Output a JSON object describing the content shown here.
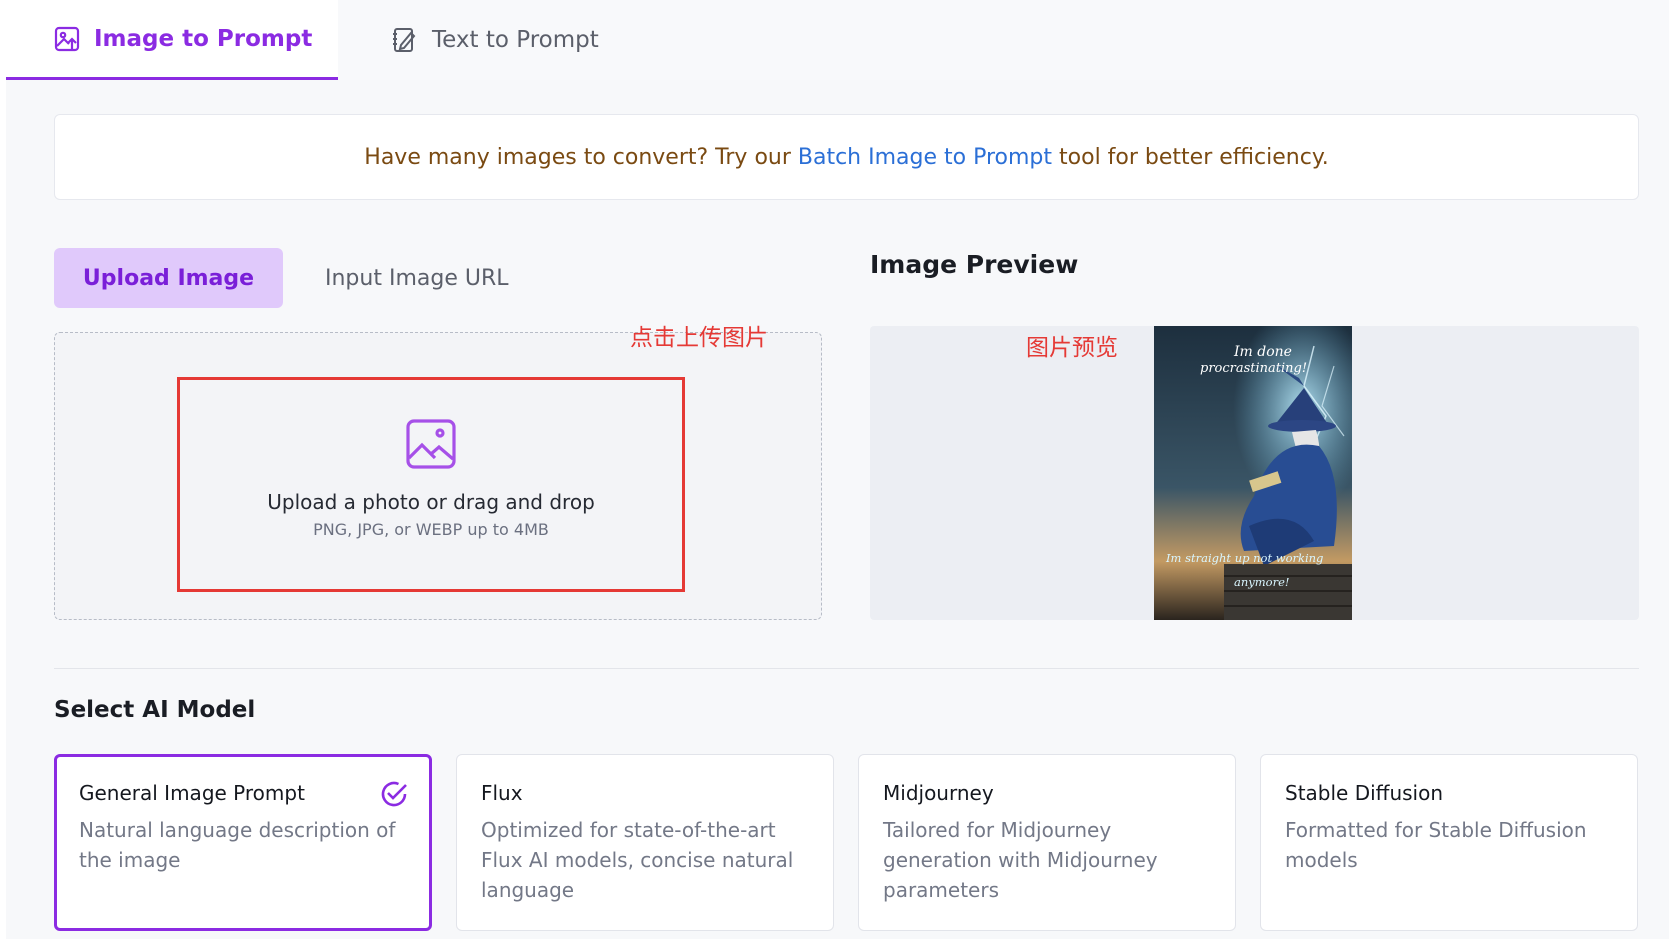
{
  "tabs": {
    "image_to_prompt": "Image to Prompt",
    "text_to_prompt": "Text to Prompt"
  },
  "banner": {
    "prefix": "Have many images to convert? Try our",
    "link": "Batch Image to Prompt",
    "suffix": "tool for better efficiency."
  },
  "upload": {
    "tab_upload": "Upload Image",
    "tab_url": "Input Image URL",
    "main_text": "Upload a photo or drag and drop",
    "sub_text": "PNG, JPG, or WEBP up to 4MB",
    "annotation": "点击上传图片"
  },
  "preview": {
    "title": "Image Preview",
    "annotation": "图片预览",
    "image_text_top_1": "Im done",
    "image_text_top_2": "procrastinating!",
    "image_text_bottom_1": "Im straight up not working",
    "image_text_bottom_2": "anymore!"
  },
  "models": {
    "title": "Select AI Model",
    "items": [
      {
        "name": "General Image Prompt",
        "description": "Natural language description of the image",
        "selected": true
      },
      {
        "name": "Flux",
        "description": "Optimized for state-of-the-art Flux AI models, concise natural language",
        "selected": false
      },
      {
        "name": "Midjourney",
        "description": "Tailored for Midjourney generation with Midjourney parameters",
        "selected": false
      },
      {
        "name": "Stable Diffusion",
        "description": "Formatted for Stable Diffusion models",
        "selected": false
      }
    ]
  },
  "colors": {
    "accent": "#8b2be2",
    "annotation": "#e53935",
    "link": "#2b6fd6"
  }
}
